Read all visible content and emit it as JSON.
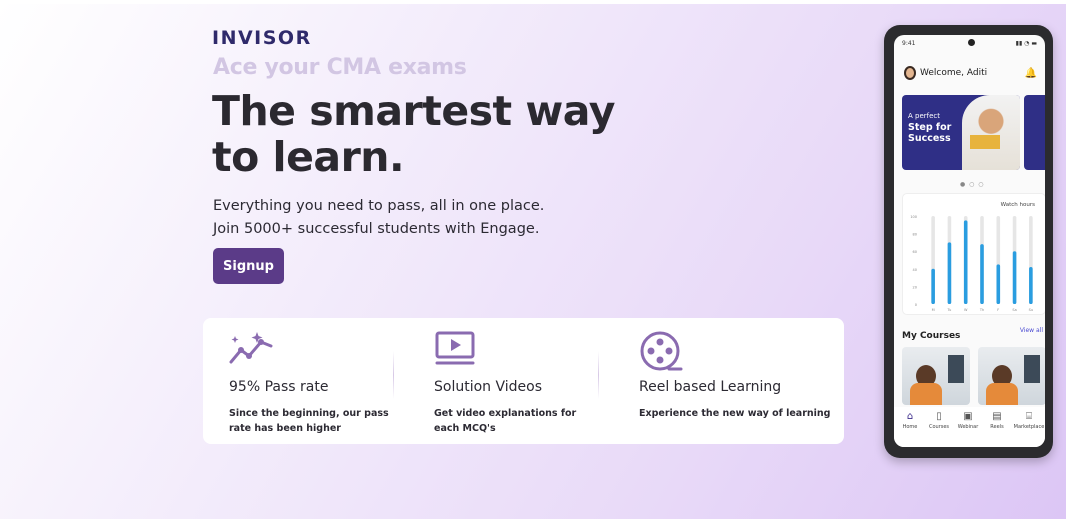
{
  "brand": {
    "logo": "INVISOR"
  },
  "hero": {
    "tagline": "Ace your CMA exams",
    "headline_line1": "The smartest way",
    "headline_line2": "to learn.",
    "sub_line1": "Everything you need to pass, all in one place.",
    "sub_line2": "Join 5000+ successful students with Engage.",
    "signup_label": "Signup"
  },
  "features": [
    {
      "icon": "trending-up-sparkle-icon",
      "title": "95% Pass rate",
      "desc_line1": "Since the beginning, our pass",
      "desc_line2": "rate has been higher"
    },
    {
      "icon": "video-play-icon",
      "title": "Solution Videos",
      "desc_line1": "Get video explanations for",
      "desc_line2": "each MCQ's"
    },
    {
      "icon": "film-reel-icon",
      "title": "Reel based Learning",
      "desc_line1": "Experience the new way of learning",
      "desc_line2": ""
    }
  ],
  "phone": {
    "time": "9:41",
    "welcome": "Welcome, Aditi",
    "banner_text_1": "A perfect",
    "banner_text_2": "Step for",
    "banner_text_3": "Success",
    "chart_title": "Watch hours",
    "my_courses": "My Courses",
    "view_all": "View all",
    "tabs": [
      "Home",
      "Courses",
      "Webinar",
      "Reels",
      "Marketplace"
    ]
  },
  "colors": {
    "accent": "#5b3b88",
    "logo": "#2f2a6b",
    "chart_bar": "#2a9de0"
  },
  "chart_data": {
    "type": "bar",
    "title": "Watch hours",
    "categories": [
      "M",
      "Tu",
      "W",
      "Th",
      "F",
      "Sa",
      "Su"
    ],
    "values": [
      40,
      70,
      95,
      68,
      45,
      60,
      42
    ],
    "ylim": [
      0,
      100
    ],
    "yticks": [
      "100",
      "80",
      "60",
      "40",
      "20",
      "0"
    ]
  }
}
